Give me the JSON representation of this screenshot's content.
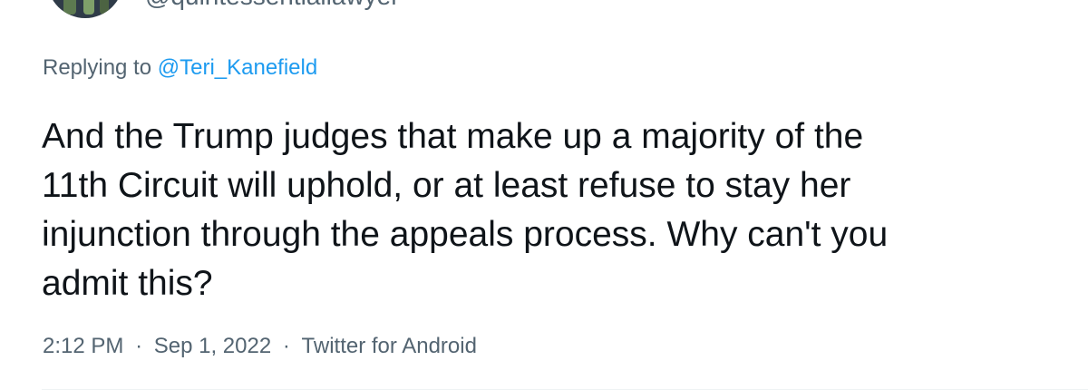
{
  "tweet": {
    "author_handle": "@quintessentiallawyer",
    "replying_prefix": "Replying to",
    "replying_to": "@Teri_Kanefield",
    "text_lines": [
      "And the Trump judges that make up a majority of the",
      "11th Circuit will uphold, or at least refuse to stay her",
      "injunction through the appeals process. Why can't you",
      "admit this?"
    ],
    "time": "2:12 PM",
    "separator": "·",
    "date": "Sep 1, 2022",
    "source": "Twitter for Android"
  },
  "colors": {
    "text": "#0f1419",
    "secondary": "#536471",
    "link": "#1d9bf0"
  }
}
